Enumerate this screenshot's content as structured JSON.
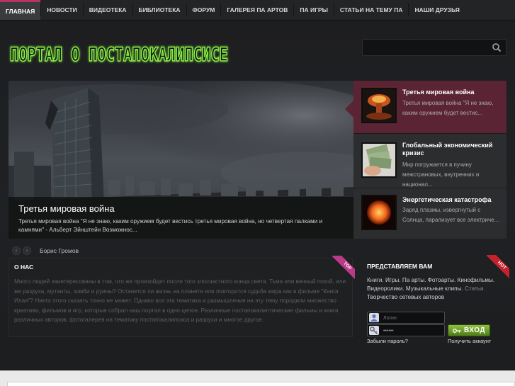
{
  "nav": {
    "items": [
      {
        "label": "ГЛАВНАЯ",
        "active": true
      },
      {
        "label": "НОВОСТИ"
      },
      {
        "label": "ВИДЕОТЕКА"
      },
      {
        "label": "БИБЛИОТЕКА"
      },
      {
        "label": "ФОРУМ"
      },
      {
        "label": "ГАЛЕРЕЯ ПА АРТОВ"
      },
      {
        "label": "ПА ИГРЫ"
      },
      {
        "label": "СТАТЬИ НА ТЕМУ ПА"
      },
      {
        "label": "НАШИ ДРУЗЬЯ"
      }
    ]
  },
  "header": {
    "logo_text": "ПОРТАЛ О ПОСТАПОКАЛИПСИСЕ",
    "search_placeholder": "",
    "search_icon": "search-icon"
  },
  "slider": {
    "hero_title": "Третья мировая война",
    "hero_text": "Третья мировая война \"Я не знаю, каким оружием будет вестись третья мировая война, но четвертая палками и камнями\" - Альберт Эйнштейн Возможнос...",
    "items": [
      {
        "title": "Третья мировая война",
        "text": "Третья мировая война \"Я не знаю, каким оружием будет вестис...",
        "thumb": "nuclear-explosion-thumb"
      },
      {
        "title": "Глобальный экономический кризис",
        "text": "Мир погружается в пучину межстрановых, внутренних и национал...",
        "thumb": "money-hand-thumb"
      },
      {
        "title": "Энергетическая катастрофа",
        "text": "Заряд плазмы, извергнутый с Солнца, парализует все электриче...",
        "thumb": "sun-flare-thumb"
      }
    ],
    "prev_label": "‹",
    "next_label": "›",
    "author": "Борис Громов"
  },
  "about": {
    "title": "О НАС",
    "badge": "TOP",
    "text": "Много людей заинтересованы в том, что же произойдет после того злосчастного конца света. Тьма или вечный покой, или же разруха, мутанты, зомби и руины? Останется ли жизнь на планете или повторится судьба мира как в фильме \"Книга Илая\"? Никто этого сказать точно не может. Однако вся эта тематика и размышления на эту тему породили множество креатива, фильмов и игр, которые собрал наш портал в одно целое. Различные постапокалиптические фильмы и книги различных авторов, фотогалерея на тематику постапокалипсиса и разрухи и многое другое."
  },
  "present": {
    "title": "ПРЕДСТАВЛЯЕМ ВАМ",
    "badge": "HOT",
    "text_main": "Книги. Игры. Па арты. Фотоарты. Кинофильмы. Видеоролики. Музыкальные клипы.",
    "text_muted": "Статьи.",
    "text_tail": "Творчество сетевых авторов"
  },
  "login": {
    "login_placeholder": "Логин",
    "password_value": "••••••",
    "button_label": "ВХОД",
    "forgot_label": "Забыли пароль?",
    "register_label": "Получить аккаунт"
  },
  "colors": {
    "accent": "#b8345e",
    "active_slide": "#5a2434",
    "logo_green": "#7be33a",
    "login_button": "#6fa12b"
  }
}
